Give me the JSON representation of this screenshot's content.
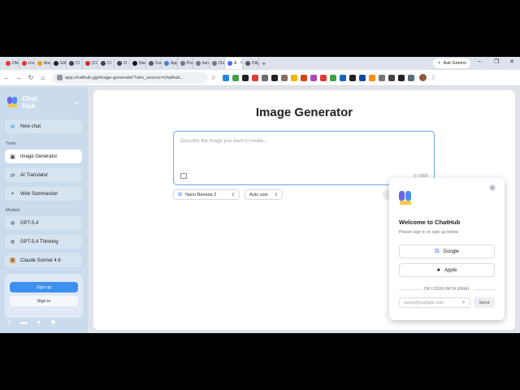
{
  "browser": {
    "tabs": [
      {
        "label": "Olive",
        "color": "#e53935"
      },
      {
        "label": "Live",
        "color": "#e53935"
      },
      {
        "label": "Anal",
        "color": "#f29b1d"
      },
      {
        "label": "GitH",
        "color": "#222222"
      },
      {
        "label": "Cl",
        "color": "#444444"
      },
      {
        "label": "(21",
        "color": "#d32f2f"
      },
      {
        "label": "Cl",
        "color": "#444444"
      },
      {
        "label": "Cl",
        "color": "#444444"
      },
      {
        "label": "New",
        "color": "#111111"
      },
      {
        "label": "Com",
        "color": "#5a5a5a"
      },
      {
        "label": "App",
        "color": "#4a7bd6"
      },
      {
        "label": "Proc",
        "color": "#7a7a7a"
      },
      {
        "label": "ken",
        "color": "#7a7a7a"
      },
      {
        "label": "Chat",
        "color": "#7a7a7a"
      },
      {
        "label": "A",
        "color": "#4b6ef5"
      },
      {
        "label": "Dify",
        "color": "#5a5a5a"
      }
    ],
    "new_tab_label": "+",
    "ask_gemini_label": "Ask Gemini",
    "url": "app.chathub.gg/image-generator?utm_source=chathub...",
    "extension_colors": [
      "#1e88e5",
      "#43a047",
      "#212121",
      "#e53935",
      "#6d6d6d",
      "#212121",
      "#8d6e63",
      "#f4b400",
      "#d84315",
      "#ab47bc",
      "#e53935",
      "#43a047",
      "#1565c0",
      "#212121",
      "#0d47a1",
      "#fb8c00",
      "#757575",
      "#424242",
      "#212121",
      "#546e7a"
    ]
  },
  "sidebar": {
    "brand_line1": "Chat",
    "brand_line2": "Hub",
    "new_chat": "New chat",
    "tools_label": "Tools",
    "tools": [
      {
        "label": "Image Generator",
        "icon": "image-icon"
      },
      {
        "label": "AI Translator",
        "icon": "translate-icon"
      },
      {
        "label": "Web Summarizer",
        "icon": "pin-icon"
      }
    ],
    "models_label": "Models",
    "models": [
      {
        "label": "GPT-5.4",
        "icon": "openai-icon"
      },
      {
        "label": "GPT-5.4 Thinking",
        "icon": "openai-icon"
      },
      {
        "label": "Claude Sonnet 4.6",
        "icon": "anthropic-icon"
      }
    ],
    "sign_up": "Sign up",
    "sign_in": "Sign in"
  },
  "main": {
    "title": "Image Generator",
    "prompt_placeholder": "Describe the image you want to create...",
    "char_counter": "0 / 2000",
    "model_select": "Nano Banana 2",
    "size_select": "Auto size"
  },
  "login_popup": {
    "welcome": "Welcome to ChatHub",
    "subtitle": "Please sign in or sign up below",
    "google": "Google",
    "apple": "Apple",
    "or_email": "OR LOGIN WITH EMAIL",
    "email_placeholder": "name@example.com",
    "send": "Send"
  }
}
